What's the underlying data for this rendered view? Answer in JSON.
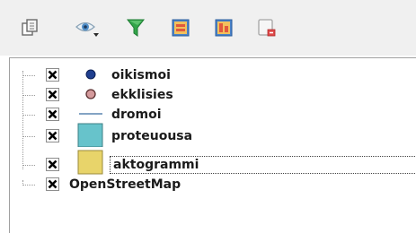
{
  "toolbar": {
    "buttons": [
      {
        "name": "add-group-button",
        "icon": "add-group-icon"
      },
      {
        "name": "manage-visibility-button",
        "icon": "eye-dropdown-icon"
      },
      {
        "name": "filter-legend-button",
        "icon": "filter-icon"
      },
      {
        "name": "expand-all-button",
        "icon": "expand-all-icon"
      },
      {
        "name": "collapse-all-button",
        "icon": "collapse-all-icon"
      },
      {
        "name": "remove-layer-button",
        "icon": "remove-layer-icon"
      }
    ]
  },
  "layers": [
    {
      "label": "oikismoi",
      "checked": true,
      "symbol": "point",
      "color": "#1f3f8f"
    },
    {
      "label": "ekklisies",
      "checked": true,
      "symbol": "point",
      "color": "#d49a9c"
    },
    {
      "label": "dromoi",
      "checked": true,
      "symbol": "line",
      "color": "#5c86b0"
    },
    {
      "label": "proteuousa",
      "checked": true,
      "symbol": "polygon",
      "color": "#67c3cb"
    },
    {
      "label": "aktogrammi",
      "checked": true,
      "symbol": "polygon",
      "color": "#e8d46a",
      "selected": true
    },
    {
      "label": "OpenStreetMap",
      "checked": true,
      "symbol": "none"
    }
  ]
}
